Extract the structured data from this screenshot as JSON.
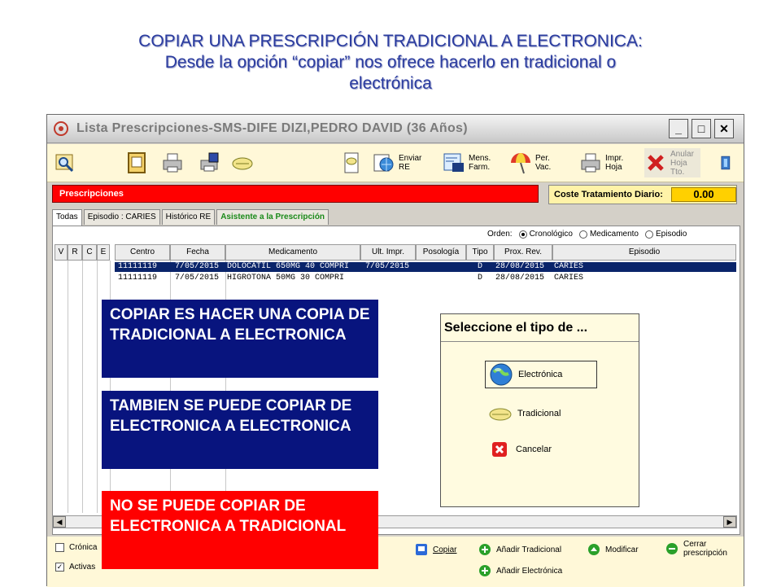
{
  "slide": {
    "title_line1": "COPIAR UNA PRESCRIPCIÓN TRADICIONAL A ELECTRONICA:",
    "title_line2": "Desde la opción “copiar” nos ofrece hacerlo en tradicional o",
    "title_line3": "electrónica"
  },
  "window": {
    "title": "Lista Prescripciones-SMS-DIFE DIZI,PEDRO DAVID (36 Años)",
    "min": "_",
    "max": "□",
    "close": "✕"
  },
  "toolbar": {
    "enviar": "Enviar\nRE",
    "mens": "Mens.\nFarm.",
    "per": "Per.\nVac.",
    "impr": "Impr.\nHoja",
    "anular": "Anular\nHoja\nTto."
  },
  "prescripciones_label": "Prescripciones",
  "coste": {
    "label": "Coste Tratamiento Diario:",
    "value": "0.00"
  },
  "tabs": [
    "Todas",
    "Episodio : CARIES",
    "Histórico RE",
    "Asistente a la Prescripción"
  ],
  "orden": {
    "label": "Orden:",
    "options": [
      "Cronológico",
      "Medicamento",
      "Episodio"
    ],
    "selected": "Cronológico"
  },
  "table": {
    "columns": [
      "V",
      "R",
      "C",
      "E",
      "Centro",
      "Fecha",
      "Medicamento",
      "Ult. Impr.",
      "Posología",
      "Tipo",
      "Prox. Rev.",
      "Episodio"
    ],
    "rows": [
      {
        "centro": "11111119",
        "fecha": "7/05/2015",
        "medicamento": "DOLOCATIL 650MG 40 COMPRI",
        "ult": "7/05/2015",
        "tipo": "D",
        "prox": "28/08/2015",
        "episodio": "CARIES"
      },
      {
        "centro": "11111119",
        "fecha": "7/05/2015",
        "medicamento": "HIGROTONA 50MG 30 COMPRI",
        "ult": "",
        "tipo": "D",
        "prox": "28/08/2015",
        "episodio": "CARIES"
      }
    ]
  },
  "bottom": {
    "cronicas": "Crónica",
    "activas": "Activas",
    "activas_mark": "✓",
    "copiar": "Copiar",
    "anadir_trad": "Añadir Tradicional",
    "modificar": "Modificar",
    "cerrar": "Cerrar\nprescripción",
    "anadir_elec": "Añadir Electrónica"
  },
  "annotations": {
    "a1": "COPIAR ES HACER UNA COPIA DE TRADICIONAL A ELECTRONICA",
    "a2": "TAMBIEN SE PUEDE COPIAR DE ELECTRONICA A ELECTRONICA",
    "a3": "NO SE PUEDE COPIAR DE ELECTRONICA A TRADICIONAL"
  },
  "dialog": {
    "title": "Seleccione el tipo de ...",
    "electronica": "Electrónica",
    "tradicional": "Tradicional",
    "cancelar": "Cancelar"
  }
}
